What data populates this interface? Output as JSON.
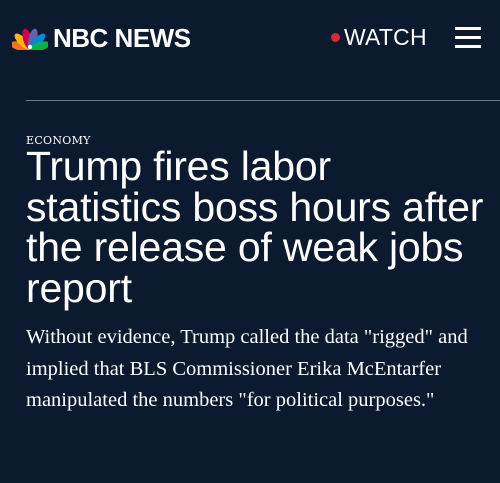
{
  "header": {
    "brand": "NBC NEWS",
    "watch_label": "WATCH",
    "live_dot_color": "#e0243c",
    "menu_icon": "hamburger-menu-icon"
  },
  "article": {
    "section": "ECONOMY",
    "headline": "Trump fires labor statistics boss hours after the release of weak jobs report",
    "dek": "Without evidence, Trump called the data \"rigged\" and implied that BLS Commissioner Erika McEntarfer manipulated the numbers \"for political purposes.\""
  },
  "colors": {
    "background": "#0b1a2e",
    "text": "#ffffff",
    "divider": "#6b7a90"
  }
}
